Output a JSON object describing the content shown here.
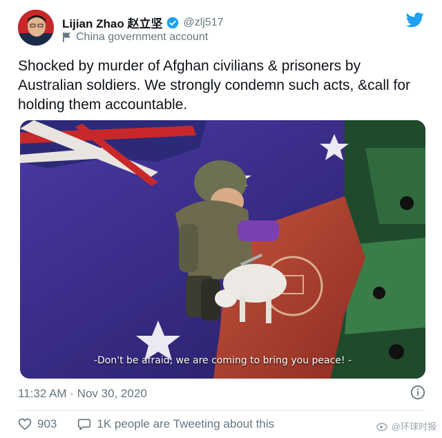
{
  "author": {
    "display_name": "Lijian Zhao 赵立坚",
    "handle": "@zlj517",
    "account_label": "China government account"
  },
  "tweet": {
    "text": "Shocked by murder of Afghan civilians & prisoners by Australian soldiers. We strongly condemn such acts, &call for holding them accountable.",
    "media_caption": "-Don't be afraid, we are coming to bring you peace! -",
    "timestamp": "11:32 AM · Nov 30, 2020"
  },
  "actions": {
    "likes": "903",
    "tweeting_about": "1K people are Tweeting about this"
  },
  "watermark": "@环球时报",
  "colors": {
    "twitter_blue": "#1da1f2",
    "flag_purple": "#3d2f8f",
    "afghan_red": "#b8432f",
    "puzzle_green": "#2f6b3e"
  },
  "icons": [
    "verified-icon",
    "government-flag-icon",
    "twitter-bird-icon",
    "info-icon",
    "heart-icon",
    "speech-bubble-icon"
  ]
}
